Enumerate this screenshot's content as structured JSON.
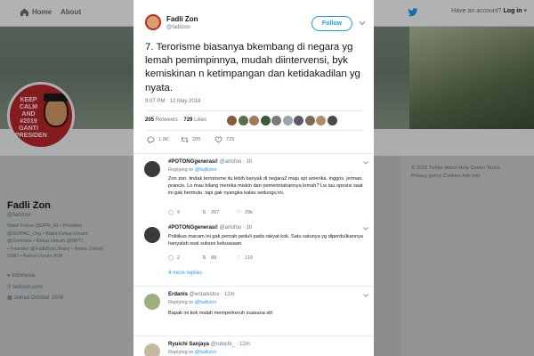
{
  "topbar": {
    "home_label": "Home",
    "about_label": "About",
    "account_prompt": "Have an account?",
    "login_label": "Log in"
  },
  "background_profile": {
    "avatar_text": [
      "KEEP",
      "CALM",
      "AND",
      "#2019",
      "GANTI",
      "PRESIDEN"
    ],
    "name": "Fadli Zon",
    "handle": "@fadlizon",
    "bio_lines": [
      "Wakil Ketua @DPR_RI • Presiden",
      "@GOPAC_Org • Wakil Ketua Umum",
      "@Gerindra • Ketua Umum @HKTI",
      "• Founder @FadliZonLibrary • Ketua Umum",
      "SNKI • Ketua Umum IKM"
    ],
    "location": "Indonesia",
    "website": "fadlizon.com",
    "joined": "Joined October 2009",
    "footer_lines": [
      "© 2018 Twitter  About  Help Center  Terms",
      "Privacy policy  Cookies  Ads info"
    ]
  },
  "tweet": {
    "author_name": "Fadli Zon",
    "author_handle": "@fadlizon",
    "follow_label": "Follow",
    "text": "7. Terorisme biasanya bkembang di negara yg lemah pemimpinnya, mudah diintervensi, byk kemiskinan n ketimpangan dan ketidakadilan yg nyata.",
    "timestamp": "9:07 PM · 12 May 2018",
    "retweets_count": "205",
    "retweets_label": "Retweets",
    "likes_count": "729",
    "likes_label": "Likes",
    "liker_colors": [
      "#8a5a3c",
      "#5b6e4f",
      "#a07a5a",
      "#3d5a3a",
      "#7a7a7a",
      "#9aa7b0",
      "#5a5a6a",
      "#7d6a5a",
      "#b58a6a",
      "#4a4a4a"
    ],
    "reply_count": "1,9K",
    "retweet_count_action": "205",
    "like_count_action": "729"
  },
  "replies": [
    {
      "name": "#POTONGgenerasi!",
      "handle": "@artofoo",
      "time": "1h",
      "replying_prefix": "Replying to",
      "replying_to": "@fadlizon",
      "body": "Zon zon. tindak terrorisme itu lebih banyak di negara2 maju spt amerika. inggris. jerman. prancis. Lo mau bilang mereka miskin dan pemerintahannya lemah? Lw tau oposisi saat ini gak bermutu. tapi gak nyangka kalau sedungu ini.",
      "reply_count": "9",
      "retweet_count": "267",
      "like_count": "29k",
      "avatar_color": "#3a3a3a"
    },
    {
      "name": "#POTONGgenerasi!",
      "handle": "@artofoo",
      "time": "1h",
      "replying_prefix": "",
      "replying_to": "",
      "body": "Politikus macam ini gak pernah peduli pada rakyat kok. Satu satunya yg diperdulikannya hanyalah soal sukses kekuasaan.",
      "reply_count": "2",
      "retweet_count": "88",
      "like_count": "119",
      "avatar_color": "#3a3a3a",
      "more_replies": "4 more replies"
    },
    {
      "name": "Erdanis",
      "handle": "@erdanistuv",
      "time": "12m",
      "replying_prefix": "Replying to",
      "replying_to": "@fadlizon",
      "body": "Bapak ini kok malah memperkeruh suasana sih",
      "avatar_color": "#9bb07a"
    },
    {
      "name": "Ryuichi Sanjaya",
      "handle": "@rubichi_",
      "time": "12m",
      "replying_prefix": "Replying to",
      "replying_to": "@fadlizon",
      "avatar_color": "#c7b8a0"
    }
  ],
  "colors": {
    "brand": "#1da1f2",
    "follow_outline": "#1da1f2",
    "avatar_bg": "#c1272d"
  }
}
